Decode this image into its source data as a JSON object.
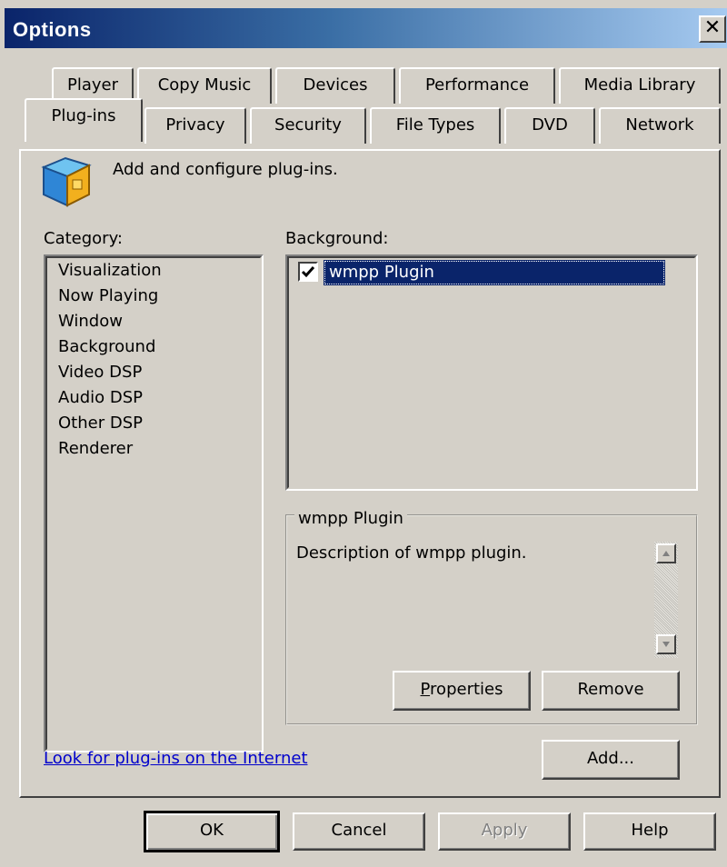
{
  "window": {
    "title": "Options",
    "close_glyph": "✕"
  },
  "tabs": {
    "row1": [
      "Player",
      "Copy Music",
      "Devices",
      "Performance",
      "Media Library"
    ],
    "row2": [
      "Plug-ins",
      "Privacy",
      "Security",
      "File Types",
      "DVD",
      "Network"
    ],
    "active": "Plug-ins"
  },
  "header": {
    "icon": "plugin-cube-icon",
    "text": "Add and configure plug-ins."
  },
  "category": {
    "label": "Category:",
    "items": [
      "Visualization",
      "Now Playing",
      "Window",
      "Background",
      "Video DSP",
      "Audio DSP",
      "Other DSP",
      "Renderer"
    ]
  },
  "background": {
    "label": "Background:",
    "items": [
      {
        "name": "wmpp Plugin",
        "checked": true,
        "selected": true
      }
    ]
  },
  "details": {
    "group_title": "wmpp Plugin",
    "description": "Description of wmpp plugin.",
    "properties_label": "Properties",
    "remove_label": "Remove"
  },
  "footer": {
    "link_text": "Look for plug-ins on the Internet",
    "add_label": "Add..."
  },
  "dialog_buttons": {
    "ok": "OK",
    "cancel": "Cancel",
    "apply": "Apply",
    "help": "Help"
  },
  "colors": {
    "titlebar_start": "#0a246a",
    "titlebar_end": "#a6caf0",
    "selection": "#0a246a",
    "face": "#d4d0c8",
    "link": "#0000cc"
  }
}
